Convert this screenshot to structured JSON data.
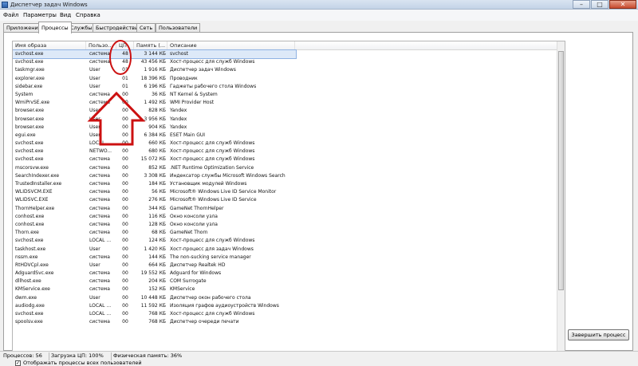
{
  "window": {
    "title": "Диспетчер задач Windows"
  },
  "menu": [
    "Файл",
    "Параметры",
    "Вид",
    "Справка"
  ],
  "tabs": [
    "Приложения",
    "Процессы",
    "Службы",
    "Быстродействие",
    "Сеть",
    "Пользователи"
  ],
  "active_tab": "Процессы",
  "columns": [
    "Имя образа",
    "Пользо...",
    "ЦП",
    "Память (...",
    "Описание"
  ],
  "rows": [
    [
      "svchost.exe",
      "система",
      "48",
      "3 144 КБ",
      "svchost"
    ],
    [
      "svchost.exe",
      "система",
      "48",
      "43 456 КБ",
      "Хост-процесс для служб Windows"
    ],
    [
      "taskmgr.exe",
      "User",
      "01",
      "1 916 КБ",
      "Диспетчер задач Windows"
    ],
    [
      "explorer.exe",
      "User",
      "01",
      "18 396 КБ",
      "Проводник"
    ],
    [
      "sidebar.exe",
      "User",
      "01",
      "6 196 КБ",
      "Гаджеты рабочего стола Windows"
    ],
    [
      "System",
      "система",
      "00",
      "36 КБ",
      "NT Kernel & System"
    ],
    [
      "WmiPrvSE.exe",
      "система",
      "00",
      "1 492 КБ",
      "WMI Provider Host"
    ],
    [
      "browser.exe",
      "User",
      "00",
      "828 КБ",
      "Yandex"
    ],
    [
      "browser.exe",
      "User",
      "00",
      "3 956 КБ",
      "Yandex"
    ],
    [
      "browser.exe",
      "User",
      "00",
      "904 КБ",
      "Yandex"
    ],
    [
      "egui.exe",
      "User",
      "00",
      "6 384 КБ",
      "ESET Main GUI"
    ],
    [
      "svchost.exe",
      "LOCAL ...",
      "00",
      "660 КБ",
      "Хост-процесс для служб Windows"
    ],
    [
      "svchost.exe",
      "NETWO...",
      "00",
      "680 КБ",
      "Хост-процесс для служб Windows"
    ],
    [
      "svchost.exe",
      "система",
      "00",
      "15 072 КБ",
      "Хост-процесс для служб Windows"
    ],
    [
      "mscorsvw.exe",
      "система",
      "00",
      "852 КБ",
      ".NET Runtime Optimization Service"
    ],
    [
      "SearchIndexer.exe",
      "система",
      "00",
      "3 308 КБ",
      "Индексатор службы Microsoft Windows Search"
    ],
    [
      "TrustedInstaller.exe",
      "система",
      "00",
      "184 КБ",
      "Установщик модулей Windows"
    ],
    [
      "WLIDSVCM.EXE",
      "система",
      "00",
      "56 КБ",
      "Microsoft® Windows Live ID Service Monitor"
    ],
    [
      "WLIDSVC.EXE",
      "система",
      "00",
      "276 КБ",
      "Microsoft® Windows Live ID Service"
    ],
    [
      "ThornHelper.exe",
      "система",
      "00",
      "344 КБ",
      "GameNet ThornHelper"
    ],
    [
      "conhost.exe",
      "система",
      "00",
      "116 КБ",
      "Окно консоли узла"
    ],
    [
      "conhost.exe",
      "система",
      "00",
      "128 КБ",
      "Окно консоли узла"
    ],
    [
      "Thorn.exe",
      "система",
      "00",
      "68 КБ",
      "GameNet Thorn"
    ],
    [
      "svchost.exe",
      "LOCAL ...",
      "00",
      "124 КБ",
      "Хост-процесс для служб Windows"
    ],
    [
      "taskhost.exe",
      "User",
      "00",
      "1 420 КБ",
      "Хост-процесс для задач Windows"
    ],
    [
      "nssm.exe",
      "система",
      "00",
      "144 КБ",
      "The non-sucking service manager"
    ],
    [
      "RtHDVCpl.exe",
      "User",
      "00",
      "664 КБ",
      "Диспетчер Realtek HD"
    ],
    [
      "AdguardSvc.exe",
      "система",
      "00",
      "19 552 КБ",
      "Adguard for Windows"
    ],
    [
      "dllhost.exe",
      "система",
      "00",
      "204 КБ",
      "COM Surrogate"
    ],
    [
      "KMService.exe",
      "система",
      "00",
      "152 КБ",
      "KMService"
    ],
    [
      "dwm.exe",
      "User",
      "00",
      "10 448 КБ",
      "Диспетчер окон рабочего стола"
    ],
    [
      "audiodg.exe",
      "LOCAL ...",
      "00",
      "11 592 КБ",
      "Изоляция графов аудиоустройств Windows"
    ],
    [
      "svchost.exe",
      "LOCAL ...",
      "00",
      "768 КБ",
      "Хост-процесс для служб Windows"
    ],
    [
      "spoolsv.exe",
      "система",
      "00",
      "768 КБ",
      "Диспетчер очереди печати"
    ]
  ],
  "show_all_label": "Отображать процессы всех пользователей",
  "end_process_label": "Завершить процесс",
  "status": {
    "processes": "Процессов: 56",
    "cpu": "Загрузка ЦП: 100%",
    "memory": "Физическая память: 36%"
  },
  "annotation_color": "#cc1111"
}
